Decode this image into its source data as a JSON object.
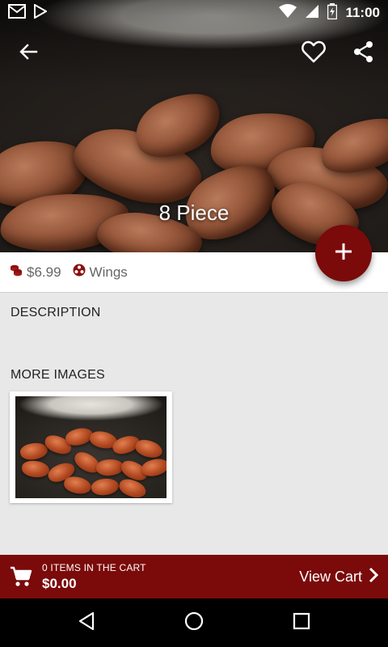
{
  "status_bar": {
    "time": "11:00"
  },
  "product": {
    "title": "8 Piece",
    "price": "$6.99",
    "category": "Wings"
  },
  "sections": {
    "description_title": "DESCRIPTION",
    "more_images_title": "MORE IMAGES"
  },
  "cart": {
    "count_label": "0 ITEMS IN THE CART",
    "total": "$0.00",
    "view_label": "View Cart"
  },
  "colors": {
    "brand": "#7b0a0a",
    "background": "#e8e8e8"
  },
  "icons": [
    "back-arrow-icon",
    "heart-icon",
    "share-icon",
    "plus-icon",
    "coins-icon",
    "category-icon",
    "cart-icon",
    "chevron-right-icon"
  ]
}
